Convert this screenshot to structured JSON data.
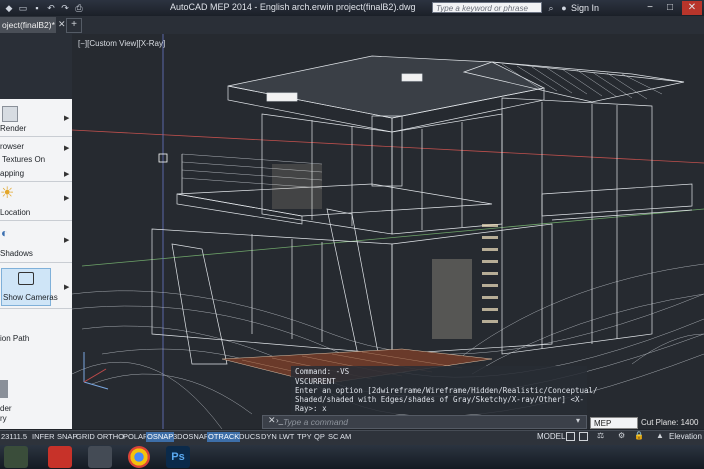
{
  "window": {
    "title": "AutoCAD MEP 2014 - English    arch.erwin project(finalB2).dwg",
    "search_placeholder": "Type a keyword or phrase",
    "sign_in": "Sign In"
  },
  "tabs": {
    "active_label": "oject(finalB2)*"
  },
  "viewport": {
    "label": "[−][Custom View][X-Ray]"
  },
  "palette": {
    "items": [
      {
        "label": "Render"
      },
      {
        "label": "rowser"
      },
      {
        "label": "Textures On"
      },
      {
        "label": "apping"
      },
      {
        "label": "Location"
      },
      {
        "label": "Shadows"
      },
      {
        "label": "Show Cameras"
      },
      {
        "label": "ion Path"
      },
      {
        "label": "der"
      },
      {
        "label": "ry"
      }
    ]
  },
  "command": {
    "history_title": "Command: -VS",
    "lines": [
      "VSCURRENT",
      "Enter an option [2dwireframe/Wireframe/Hidden/Realistic/Conceptual/",
      "Shaded/shaded with Edges/shades of Gray/Sketchy/X-ray/Other] <X-",
      "Ray>: x"
    ],
    "input_placeholder": "Type a command"
  },
  "workspace": {
    "dropdown": "MEP Design",
    "cut_plane_label": "Cut Plane:",
    "cut_plane_value": "1400"
  },
  "statusbar": {
    "coords": "23111.5",
    "toggles": [
      {
        "label": "INFER",
        "on": false
      },
      {
        "label": "SNAP",
        "on": false
      },
      {
        "label": "GRID",
        "on": false
      },
      {
        "label": "ORTHO",
        "on": false
      },
      {
        "label": "POLAR",
        "on": false
      },
      {
        "label": "OSNAP",
        "on": true
      },
      {
        "label": "3DOSNAP",
        "on": false
      },
      {
        "label": "OTRACK",
        "on": true
      },
      {
        "label": "DUCS",
        "on": false
      },
      {
        "label": "DYN",
        "on": false
      },
      {
        "label": "LWT",
        "on": false
      },
      {
        "label": "TPY",
        "on": false
      },
      {
        "label": "QP",
        "on": false
      },
      {
        "label": "SC",
        "on": false
      },
      {
        "label": "AM",
        "on": false
      }
    ],
    "model": "MODEL",
    "elevation": "Elevation"
  },
  "taskbar": {
    "ps_label": "Ps"
  }
}
